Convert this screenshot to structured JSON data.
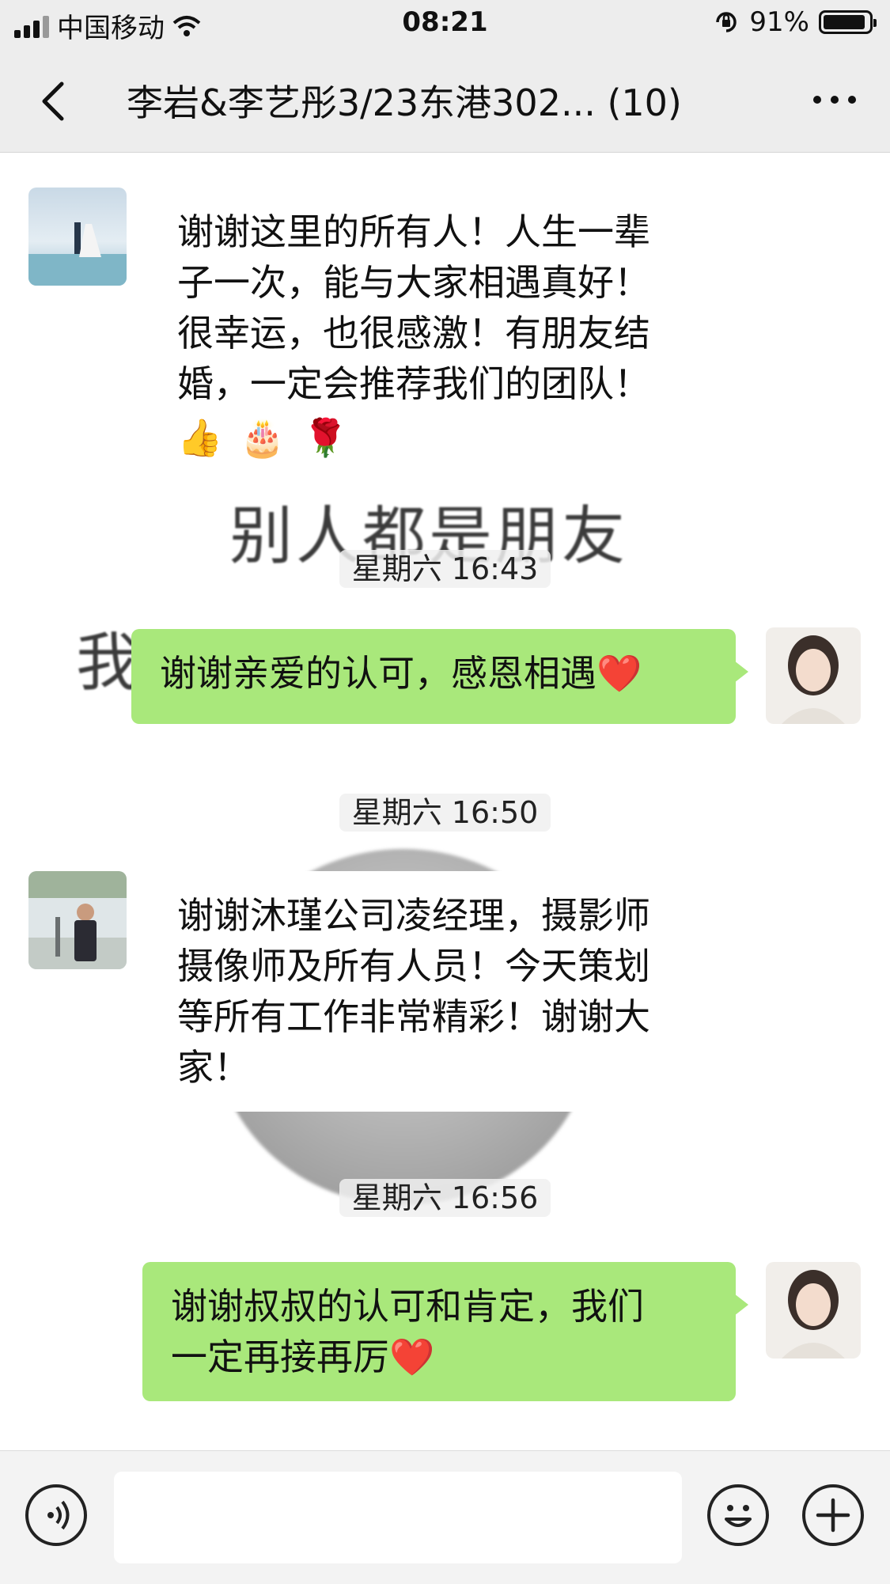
{
  "status_bar": {
    "carrier": "中国移动",
    "time": "08:21",
    "battery_percent": "91%",
    "battery_level": 0.91
  },
  "nav": {
    "title": "李岩&李艺彤3/23东港302... (10)"
  },
  "messages": [
    {
      "side": "in",
      "text_lines": [
        "谢谢这里的所有人！人生一辈",
        "子一次，能与大家相遇真好！",
        "很幸运，也很感激！有朋友结",
        "婚，一定会推荐我们的团队！"
      ],
      "emoji": [
        "👍",
        "🎂",
        "🌹"
      ]
    },
    {
      "side": "out",
      "text": "谢谢亲爱的认可，感恩相遇❤️"
    },
    {
      "side": "in",
      "text_lines": [
        "谢谢沐瑾公司凌经理，摄影师",
        "摄像师及所有人员！今天策划",
        "等所有工作非常精彩！谢谢大",
        "家！"
      ]
    },
    {
      "side": "out",
      "text_lines": [
        "谢谢叔叔的认可和肯定，我们",
        "一定再接再厉❤️"
      ]
    }
  ],
  "timestamps": [
    "星期六 16:43",
    "星期六 16:50",
    "星期六 16:56"
  ],
  "stickers": {
    "line1": "别人都是朋友",
    "line2_partial": "我"
  },
  "colors": {
    "outgoing_bubble": "#a9e87b",
    "bar_background": "#ededed"
  },
  "icons": {
    "back": "chevron-left-icon",
    "more": "more-icon",
    "voice": "voice-icon",
    "emoji": "emoji-icon",
    "add": "add-icon"
  }
}
